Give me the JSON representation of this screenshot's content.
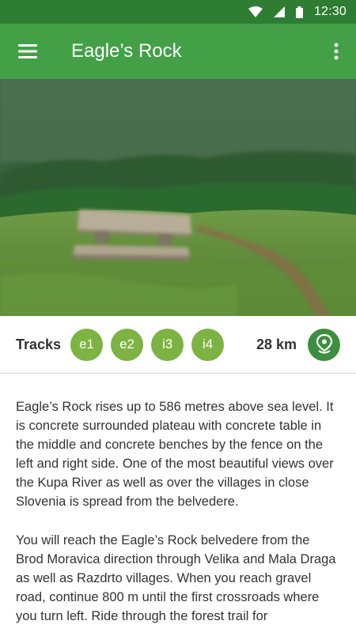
{
  "status_bar": {
    "time": "12:30",
    "icons": [
      "wifi-icon",
      "signal-icon",
      "battery-icon"
    ],
    "color": "#2e7d32"
  },
  "app_bar": {
    "title": "Eagle’s Rock",
    "menu_icon": "hamburger-menu-icon",
    "more_icon": "more-vertical-icon",
    "color": "#43a047"
  },
  "hero": {
    "image": "photo of green hillside meadow with a concrete table and bench, forest in the background"
  },
  "info": {
    "tracks_label": "Tracks",
    "tracks": [
      "e1",
      "e2",
      "i3",
      "i4"
    ],
    "distance": "28 km",
    "map_icon": "map-pin-icon",
    "badge_color": "#7cb342"
  },
  "content": {
    "paragraphs": [
      "Eagle’s Rock rises up to 586 metres above sea level. It is concrete surrounded plateau with concrete table in the middle and concrete benches by the fence on the left and right side. One of the most beautiful views over the Kupa River as well as over the villages in close Slovenia is spread from the belvedere.",
      "You will reach the Eagle’s Rock belvedere from the Brod Moravica direction through Velika and Mala Draga as well as Razdrto villages. When you reach gravel road, continue 800 m until the first crossroads where you turn left. Ride through the forest trail for"
    ]
  }
}
